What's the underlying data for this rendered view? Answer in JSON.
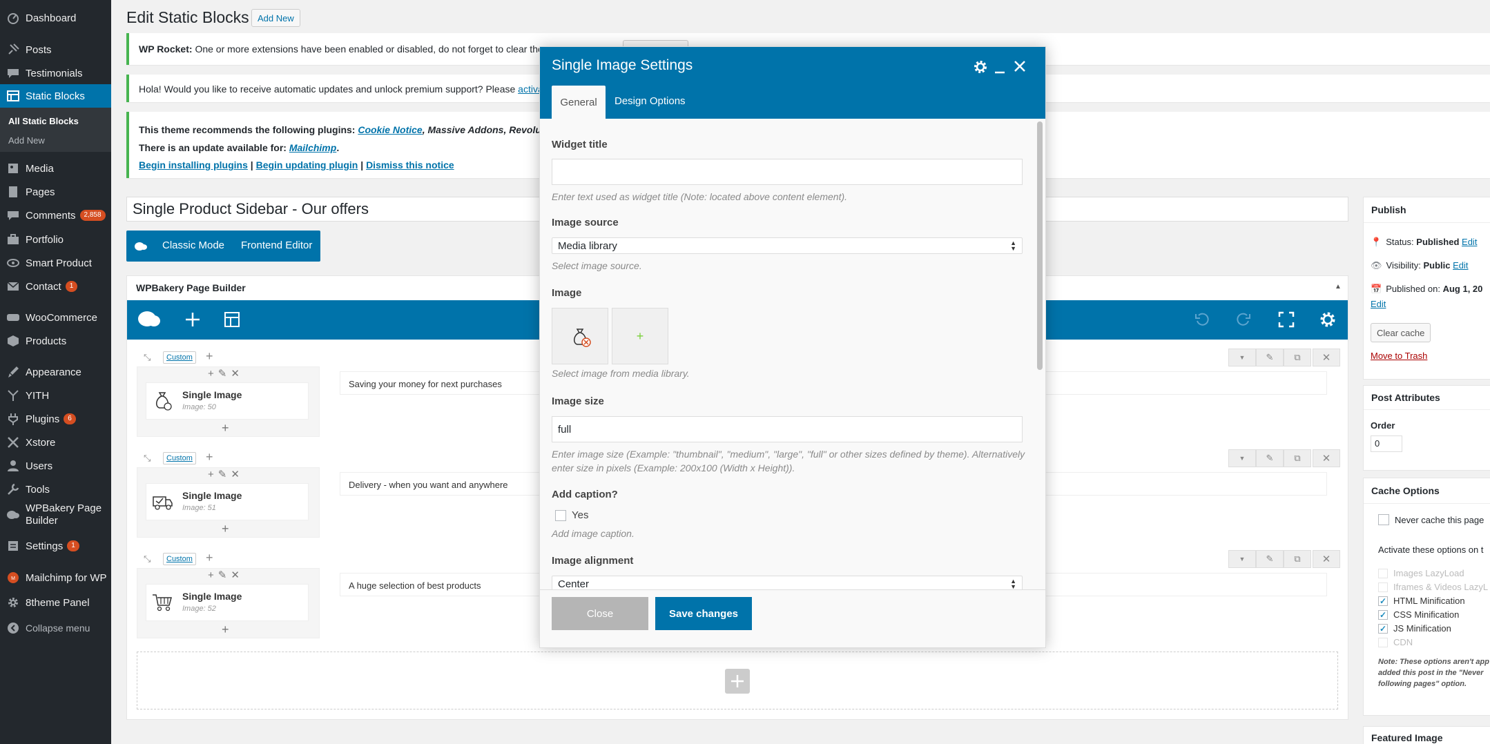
{
  "sidebar": {
    "items": [
      {
        "label": "Dashboard",
        "icon": "dashboard-icon"
      },
      {
        "label": "Posts",
        "icon": "pin-icon"
      },
      {
        "label": "Testimonials",
        "icon": "comment-icon"
      },
      {
        "label": "Static Blocks",
        "icon": "blocks-icon"
      },
      {
        "label": "Media",
        "icon": "media-icon"
      },
      {
        "label": "Pages",
        "icon": "page-icon"
      },
      {
        "label": "Comments",
        "icon": "comment-icon",
        "badge": "2,858"
      },
      {
        "label": "Portfolio",
        "icon": "portfolio-icon"
      },
      {
        "label": "Smart Product",
        "icon": "eye-icon"
      },
      {
        "label": "Contact",
        "icon": "mail-icon",
        "badge": "1"
      },
      {
        "label": "WooCommerce",
        "icon": "woo-icon"
      },
      {
        "label": "Products",
        "icon": "products-icon"
      },
      {
        "label": "Appearance",
        "icon": "brush-icon"
      },
      {
        "label": "YITH",
        "icon": "yith-icon"
      },
      {
        "label": "Plugins",
        "icon": "plug-icon",
        "badge": "6"
      },
      {
        "label": "Xstore",
        "icon": "xstore-icon"
      },
      {
        "label": "Users",
        "icon": "user-icon"
      },
      {
        "label": "Tools",
        "icon": "wrench-icon"
      },
      {
        "label": "WPBakery Page Builder",
        "icon": "wpbakery-icon"
      },
      {
        "label": "Settings",
        "icon": "settings-icon",
        "badge": "1"
      },
      {
        "label": "Mailchimp for WP",
        "icon": "mailchimp-icon"
      },
      {
        "label": "8theme Panel",
        "icon": "gear-icon"
      },
      {
        "label": "Collapse menu",
        "icon": "collapse-icon"
      }
    ],
    "sub": [
      "All Static Blocks",
      "Add New"
    ]
  },
  "header": {
    "title": "Edit Static Blocks",
    "add_new": "Add New"
  },
  "notices": {
    "rocket_strong": "WP Rocket:",
    "rocket_text": "One or more extensions have been enabled or disabled, do not forget to clear the c",
    "update_text": "Hola! Would you like to receive automatic updates and unlock premium support? Please ",
    "update_link": "activat",
    "theme_prefix": "This theme recommends the following plugins: ",
    "theme_link1": "Cookie Notice",
    "theme_rest": ", Massive Addons, Revolution",
    "update_prefix": "There is an update available for: ",
    "update_plugin": "Mailchimp",
    "link_install": "Begin installing plugins",
    "link_update": "Begin updating plugin",
    "link_dismiss": "Dismiss this notice",
    "sep": " | "
  },
  "post_title": "Single Product Sidebar - Our offers",
  "editor_buttons": {
    "classic": "Classic Mode",
    "frontend": "Frontend Editor"
  },
  "builder": {
    "title": "WPBakery Page Builder",
    "rows": [
      {
        "custom": "Custom",
        "element": "Single Image",
        "meta": "Image: 50",
        "text": "Saving your money for next purchases"
      },
      {
        "custom": "Custom",
        "element": "Single Image",
        "meta": "Image: 51",
        "text": "Delivery - when you want and anywhere"
      },
      {
        "custom": "Custom",
        "element": "Single Image",
        "meta": "Image: 52",
        "text": "A huge selection of best products"
      }
    ]
  },
  "publish": {
    "title": "Publish",
    "status_label": "Status:",
    "status_value": "Published",
    "status_edit": "Edit",
    "visibility_label": "Visibility:",
    "visibility_value": "Public",
    "visibility_edit": "Edit",
    "published_label": "Published on:",
    "published_value": "Aug 1, 20",
    "published_edit": "Edit",
    "clear_cache": "Clear cache",
    "trash": "Move to Trash"
  },
  "attributes": {
    "title": "Post Attributes",
    "order_label": "Order",
    "order_value": "0"
  },
  "cache": {
    "title": "Cache Options",
    "never": "Never cache this page",
    "activate": "Activate these options on t",
    "options": [
      {
        "label": "Images LazyLoad",
        "checked": false,
        "disabled": true
      },
      {
        "label": "Iframes & Videos LazyL",
        "checked": false,
        "disabled": true
      },
      {
        "label": "HTML Minification",
        "checked": true,
        "disabled": false
      },
      {
        "label": "CSS Minification",
        "checked": true,
        "disabled": false
      },
      {
        "label": "JS Minification",
        "checked": true,
        "disabled": false
      },
      {
        "label": "CDN",
        "checked": false,
        "disabled": true
      }
    ],
    "note1": "Note: These options aren't app",
    "note2": "added this post in the \"Never",
    "note3": "following pages\" option."
  },
  "featured": {
    "title": "Featured Image"
  },
  "modal": {
    "title": "Single Image Settings",
    "tabs": [
      "General",
      "Design Options"
    ],
    "widget_title_label": "Widget title",
    "widget_title_value": "",
    "widget_title_help": "Enter text used as widget title (Note: located above content element).",
    "source_label": "Image source",
    "source_value": "Media library",
    "source_help": "Select image source.",
    "image_label": "Image",
    "image_help": "Select image from media library.",
    "size_label": "Image size",
    "size_value": "full",
    "size_help1": "Enter image size (Example: \"thumbnail\", \"medium\", \"large\", \"full\" or other sizes defined by theme). Alternatively",
    "size_help2": "enter size in pixels (Example: 200x100 (Width x Height)).",
    "caption_label": "Add caption?",
    "caption_yes": "Yes",
    "caption_help": "Add image caption.",
    "align_label": "Image alignment",
    "align_value": "Center",
    "close": "Close",
    "save": "Save changes"
  },
  "colors": {
    "primary": "#0073aa",
    "sidebar": "#23282d",
    "notice": "#46b450",
    "danger": "#a00",
    "badge": "#d54e21"
  }
}
